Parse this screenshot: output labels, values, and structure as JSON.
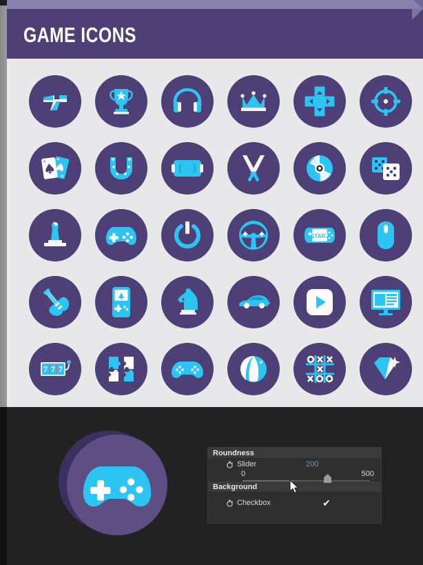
{
  "window": {
    "title": "GAME ICONS",
    "header_bg": "#4e4076",
    "board_bg": "#e8e7e9",
    "panel_bg": "#222222",
    "icon_disc_color": "#4e4076",
    "icon_accent_color": "#2bc4f3",
    "icon_light_color": "#f5f5f5"
  },
  "icon_grid": {
    "columns": 6,
    "rows": 5,
    "items": [
      {
        "name": "ray-gun-icon",
        "label": "Ray Gun"
      },
      {
        "name": "trophy-icon",
        "label": "Trophy"
      },
      {
        "name": "headphones-icon",
        "label": "Headphones"
      },
      {
        "name": "crown-icon",
        "label": "Crown"
      },
      {
        "name": "d-pad-icon",
        "label": "D-Pad"
      },
      {
        "name": "crosshair-icon",
        "label": "Crosshair"
      },
      {
        "name": "playing-cards-icon",
        "label": "Playing Cards"
      },
      {
        "name": "horseshoe-icon",
        "label": "Horseshoe"
      },
      {
        "name": "handheld-console-icon",
        "label": "Handheld Console"
      },
      {
        "name": "crossed-swords-icon",
        "label": "Crossed Swords"
      },
      {
        "name": "compact-disc-icon",
        "label": "Compact Disc"
      },
      {
        "name": "dice-icon",
        "label": "Dice"
      },
      {
        "name": "arcade-joystick-icon",
        "label": "Arcade Joystick"
      },
      {
        "name": "gamepad-icon",
        "label": "Gamepad"
      },
      {
        "name": "power-button-icon",
        "label": "Power Button"
      },
      {
        "name": "steering-wheel-icon",
        "label": "Steering Wheel"
      },
      {
        "name": "start-console-icon",
        "label": "START Console",
        "text": "START"
      },
      {
        "name": "computer-mouse-icon",
        "label": "Computer Mouse"
      },
      {
        "name": "electric-guitar-icon",
        "label": "Electric Guitar"
      },
      {
        "name": "game-boy-icon",
        "label": "Game Boy"
      },
      {
        "name": "chess-knight-icon",
        "label": "Chess Knight"
      },
      {
        "name": "race-car-icon",
        "label": "Race Car"
      },
      {
        "name": "play-button-icon",
        "label": "Play Button"
      },
      {
        "name": "monitor-icon",
        "label": "Monitor"
      },
      {
        "name": "slot-machine-icon",
        "label": "Slot Machine",
        "text": "777"
      },
      {
        "name": "puzzle-pieces-icon",
        "label": "Puzzle Pieces"
      },
      {
        "name": "controller-icon",
        "label": "Controller"
      },
      {
        "name": "beach-ball-icon",
        "label": "Beach Ball"
      },
      {
        "name": "tic-tac-toe-icon",
        "label": "Tic Tac Toe"
      },
      {
        "name": "diamond-icon",
        "label": "Diamond"
      }
    ]
  },
  "preview": {
    "icon_name": "gamepad-icon",
    "label": "Gamepad"
  },
  "inspector": {
    "roundness": {
      "section_label": "Roundness",
      "property_label": "Slider",
      "value": "200",
      "min": "0",
      "max": "500",
      "value_color": "#4aa8d8"
    },
    "background": {
      "section_label": "Background",
      "property_label": "Checkbox",
      "checked": true,
      "check_glyph": "✔"
    }
  },
  "cursor": {
    "name": "mouse-pointer"
  }
}
